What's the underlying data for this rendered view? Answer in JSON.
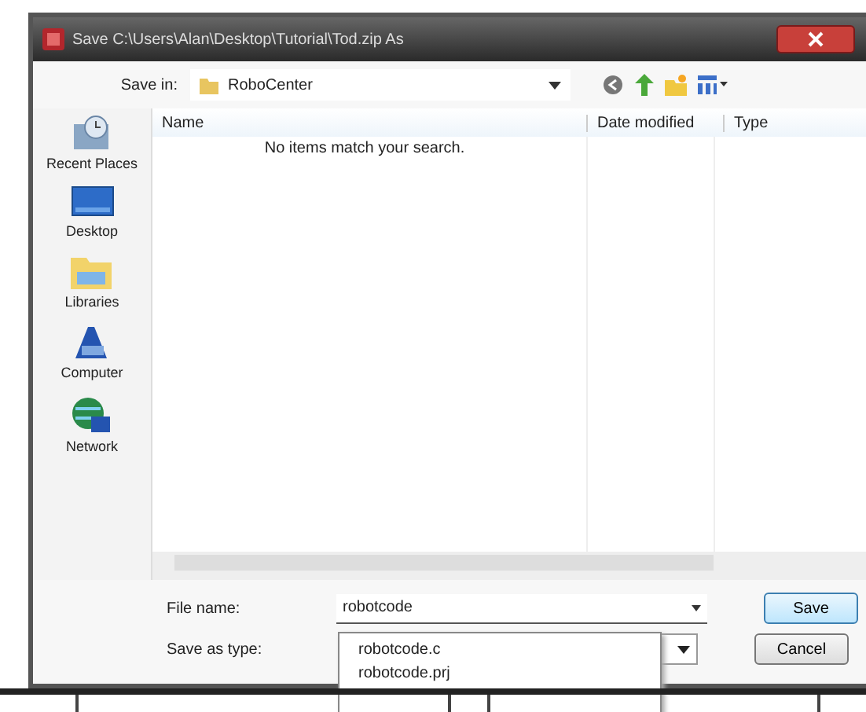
{
  "window": {
    "title": "Save C:\\Users\\Alan\\Desktop\\Tutorial\\Tod.zip As"
  },
  "toolbar": {
    "label": "Save in:",
    "folder": "RoboCenter"
  },
  "places": [
    {
      "label": "Recent Places",
      "kind": "recent"
    },
    {
      "label": "Desktop",
      "kind": "desktop"
    },
    {
      "label": "Libraries",
      "kind": "libraries"
    },
    {
      "label": "Computer",
      "kind": "computer"
    },
    {
      "label": "Network",
      "kind": "network"
    }
  ],
  "table": {
    "columns": [
      "Name",
      "Date modified",
      "Type"
    ],
    "empty_message": "No items match your search."
  },
  "file_name": {
    "label": "File name:",
    "value": "robotcode"
  },
  "save_as_type": {
    "label": "Save as type:"
  },
  "suggestions": [
    "robotcode.c",
    "robotcode.prj"
  ],
  "buttons": [
    "Save",
    "Cancel"
  ]
}
